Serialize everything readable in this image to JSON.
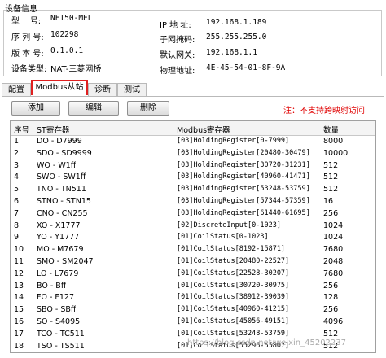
{
  "device_info": {
    "title": "设备信息",
    "model_label": "型    号:",
    "model_value": "NET50-MEL",
    "serial_label": "序 列 号:",
    "serial_value": "102298",
    "version_label": "版 本 号:",
    "version_value": "0.1.0.1",
    "type_label": "设备类型:",
    "type_value": "NAT-三菱网桥",
    "ip_label": "IP 地 址:",
    "ip_value": "192.168.1.189",
    "mask_label": "子网掩码:",
    "mask_value": "255.255.255.0",
    "gateway_label": "默认网关:",
    "gateway_value": "192.168.1.1",
    "mac_label": "物理地址:",
    "mac_value": "4E-45-54-01-8F-9A"
  },
  "tabs": [
    "配置",
    "Modbus从站",
    "诊断",
    "测试"
  ],
  "toolbar": {
    "add": "添加",
    "edit": "编辑",
    "delete": "删除",
    "note": "注：不支持跨映射访问"
  },
  "table": {
    "headers": [
      "序号",
      "ST寄存器",
      "Modbus寄存器",
      "数量"
    ],
    "rows": [
      [
        "1",
        "DO - D7999",
        "[03]HoldingRegister[0-7999]",
        "8000"
      ],
      [
        "2",
        "SDO - SD9999",
        "[03]HoldingRegister[20480-30479]",
        "10000"
      ],
      [
        "3",
        "WO - W1ff",
        "[03]HoldingRegister[30720-31231]",
        "512"
      ],
      [
        "4",
        "SWO - SW1ff",
        "[03]HoldingRegister[40960-41471]",
        "512"
      ],
      [
        "5",
        "TNO - TN511",
        "[03]HoldingRegister[53248-53759]",
        "512"
      ],
      [
        "6",
        "STNO - STN15",
        "[03]HoldingRegister[57344-57359]",
        "16"
      ],
      [
        "7",
        "CNO - CN255",
        "[03]HoldingRegister[61440-61695]",
        "256"
      ],
      [
        "8",
        "XO - X1777",
        "[02]DiscreteInput[0-1023]",
        "1024"
      ],
      [
        "9",
        "YO - Y1777",
        "[01]CoilStatus[0-1023]",
        "1024"
      ],
      [
        "10",
        "MO - M7679",
        "[01]CoilStatus[8192-15871]",
        "7680"
      ],
      [
        "11",
        "SMO - SM2047",
        "[01]CoilStatus[20480-22527]",
        "2048"
      ],
      [
        "12",
        "LO - L7679",
        "[01]CoilStatus[22528-30207]",
        "7680"
      ],
      [
        "13",
        "BO - Bff",
        "[01]CoilStatus[30720-30975]",
        "256"
      ],
      [
        "14",
        "FO - F127",
        "[01]CoilStatus[38912-39039]",
        "128"
      ],
      [
        "15",
        "SBO - SBff",
        "[01]CoilStatus[40960-41215]",
        "256"
      ],
      [
        "16",
        "SO - S4095",
        "[01]CoilStatus[45056-49151]",
        "4096"
      ],
      [
        "17",
        "TCO - TC511",
        "[01]CoilStatus[53248-53759]",
        "512"
      ],
      [
        "18",
        "TSO - TS511",
        "[01]CoilStatus[55296-55807]",
        "512"
      ]
    ]
  },
  "watermark": "https://blog.csdn.net/weixin_45202237"
}
